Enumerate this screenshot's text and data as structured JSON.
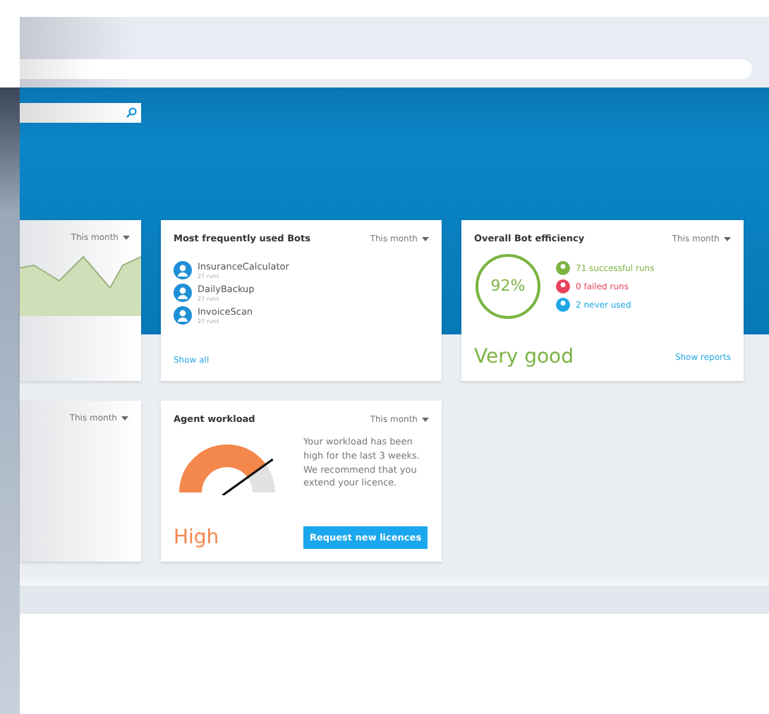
{
  "left_cards": [
    {
      "period": "This month"
    },
    {
      "period": "This month"
    }
  ],
  "bots_card": {
    "title": "Most frequently used Bots",
    "period": "This month",
    "bots": [
      {
        "name": "InsuranceCalculator",
        "runs": "27 runs"
      },
      {
        "name": "DailyBackup",
        "runs": "27 runs"
      },
      {
        "name": "InvoiceScan",
        "runs": "27 runs"
      }
    ],
    "link": "Show all"
  },
  "efficiency_card": {
    "title": "Overall Bot efficiency",
    "period": "This month",
    "percent": "92%",
    "stats": [
      {
        "label": "71 successful runs",
        "color": "#7cb342"
      },
      {
        "label": "0 failed runs",
        "color": "#e8435a"
      },
      {
        "label": "2 never used",
        "color": "#1ea7e8"
      }
    ],
    "rating": "Very good",
    "link": "Show reports"
  },
  "workload_card": {
    "title": "Agent workload",
    "period": "This month",
    "level": 0.8,
    "rating": "High",
    "message": "Your workload has been high for the last 3 weeks. We recommend that you extend your licence.",
    "button": "Request new licences"
  }
}
